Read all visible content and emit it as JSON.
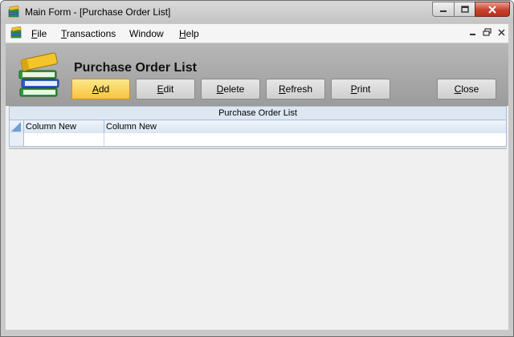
{
  "window": {
    "title": "Main Form - [Purchase Order List]",
    "icon": "books-icon"
  },
  "menu": {
    "items": [
      {
        "label": "File",
        "mnemonic": "F",
        "rest": "ile"
      },
      {
        "label": "Transactions",
        "mnemonic": "T",
        "rest": "ransactions"
      },
      {
        "label": "Window",
        "mnemonic": "",
        "rest": "Window"
      },
      {
        "label": "Help",
        "mnemonic": "H",
        "rest": "elp"
      }
    ],
    "mdi_controls": [
      "minimize-icon",
      "restore-icon",
      "close-icon"
    ]
  },
  "header": {
    "title": "Purchase Order List",
    "logo_icon": "books-stack-icon"
  },
  "toolbar": {
    "add": {
      "label": "Add",
      "mnemonic": "A",
      "rest": "dd"
    },
    "edit": {
      "label": "Edit",
      "mnemonic": "E",
      "rest": "dit"
    },
    "delete": {
      "label": "Delete",
      "mnemonic": "D",
      "rest": "elete"
    },
    "refresh": {
      "label": "Refresh",
      "mnemonic": "R",
      "rest": "efresh"
    },
    "print": {
      "label": "Print",
      "mnemonic": "P",
      "rest": "rint"
    },
    "close": {
      "label": "Close",
      "mnemonic": "C",
      "rest": "lose"
    }
  },
  "grid": {
    "caption": "Purchase Order List",
    "columns": [
      "Column New",
      "Column New"
    ],
    "rows": [
      [
        "",
        ""
      ]
    ]
  },
  "colors": {
    "primary_button": "#f7c43d",
    "grid_header": "#dde7f2",
    "close_button": "#c7412e"
  }
}
